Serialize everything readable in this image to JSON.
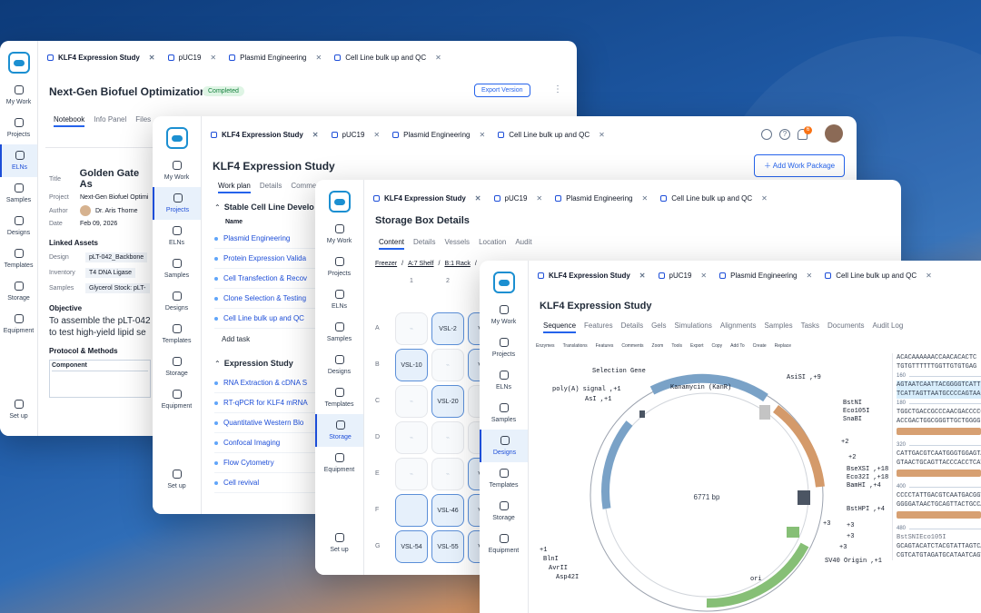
{
  "tabs": {
    "klf4": "KLF4 Expression Study",
    "puc19": "pUC19",
    "plasmid": "Plasmid Engineering",
    "cellline": "Cell Line bulk up and QC"
  },
  "nav": {
    "mywork": "My Work",
    "projects": "Projects",
    "elns": "ELNs",
    "samples": "Samples",
    "designs": "Designs",
    "templates": "Templates",
    "storage": "Storage",
    "equipment": "Equipment",
    "setup": "Set up"
  },
  "win1": {
    "title": "Next-Gen Biofuel Optimization",
    "status": "Completed",
    "export": "Export Version",
    "subtabs": [
      "Notebook",
      "Info Panel",
      "Files"
    ],
    "doc": {
      "title_label": "Title",
      "title_value": "Golden Gate As",
      "project_label": "Project",
      "project_value": "Next-Gen Biofuel Optimi",
      "author_label": "Author",
      "author_value": "Dr. Aris Thorne",
      "date_label": "Date",
      "date_value": "Feb 09, 2026",
      "linked_assets": "Linked Assets",
      "design_label": "Design",
      "design_value": "pLT-042_Backbone",
      "inventory_label": "Inventory",
      "inventory_value": "T4 DNA Ligase",
      "samples_label": "Samples",
      "samples_value": "Glycerol Stock: pLT-",
      "objective": "Objective",
      "objective_text1": "To assemble the pLT-042",
      "objective_text2": "to test high-yield lipid se",
      "protocol": "Protocol & Methods",
      "component": "Component"
    }
  },
  "win2": {
    "title": "KLF4 Expression Study",
    "add_package": "Add Work Package",
    "notif": "6",
    "subtabs": [
      "Work plan",
      "Details",
      "Commer"
    ],
    "group1": "Stable Cell Line Develo",
    "name_col": "Name",
    "items1": [
      "Plasmid Engineering",
      "Protein Expression Valida",
      "Cell Transfection & Recov",
      "Clone Selection & Testing",
      "Cell Line bulk up and QC"
    ],
    "add_task": "Add task",
    "group2": "Expression Study",
    "items2": [
      "RNA Extraction & cDNA S",
      "RT-qPCR for KLF4 mRNA",
      "Quantitative Western Blo",
      "Confocal Imaging",
      "Flow Cytometry",
      "Cell revival"
    ]
  },
  "win3": {
    "title": "Storage Box Details",
    "subtabs": [
      "Content",
      "Details",
      "Vessels",
      "Location",
      "Audit"
    ],
    "breadcrumb": [
      "Freezer",
      "A:7 Shelf",
      "B:1 Rack"
    ],
    "cols": [
      "1",
      "2",
      "3"
    ],
    "rows": [
      "A",
      "B",
      "C",
      "D",
      "E",
      "F",
      "G"
    ],
    "cells": [
      [
        "",
        "VSL-2",
        "VSL"
      ],
      [
        "VSL-10",
        "",
        "VSL"
      ],
      [
        "",
        "VSL-20",
        ""
      ],
      [
        "",
        "",
        ""
      ],
      [
        "",
        "",
        "VSL"
      ],
      [
        "",
        "VSL-46",
        "VSL"
      ],
      [
        "VSL-54",
        "VSL-55",
        "VSL"
      ]
    ]
  },
  "win4": {
    "title": "KLF4 Expression Study",
    "subtabs": [
      "Sequence",
      "Features",
      "Details",
      "Gels",
      "Simulations",
      "Alignments",
      "Samples",
      "Tasks",
      "Documents",
      "Audit Log"
    ],
    "toolbar": [
      "Enzymes",
      "Translations",
      "Features",
      "Comments",
      "Zoom",
      "Tools",
      "Export",
      "Copy",
      "Add To",
      "Create",
      "Replace"
    ],
    "plasmid_size": "6771 bp",
    "labels": [
      "Selection Gene",
      "poly(A) signal ,+1",
      "AsiSI ,+9",
      "AsI ,+1",
      "Kanamycin (KanR)",
      "BstNI",
      "Eco105I",
      "SnaBI",
      "BseXSI ,+18",
      "Eco32I ,+18",
      "BamHI ,+4",
      "BstHPI ,+4",
      "SV40 Origin ,+1",
      "BlnI",
      "AvrII",
      "Asp42I",
      "ori",
      "+2",
      "+2",
      "+3",
      "+3",
      "+3",
      "+3",
      "+1"
    ],
    "seq": [
      "ACACAAAAAACCAACACACTC",
      "TGTGTTTTTTGGTTGTGTGAG",
      "160",
      "AGTAATCAATTACGGGGTCATT",
      "TCATTAGTTAATGCCCCAGTAA",
      "180",
      "TGGCTGACCGCCCAACGACCCCC",
      "ACCGACTGGCGGGTTGCTGGGG",
      "320",
      "CATTGACGTCAATGGGTGGAGTA",
      "GTAACTGCAGTTACCCACCTCAT",
      "400",
      "CCCCTATTGACGTCAATGACGGT",
      "GGGGATAACTGCAGTTACTGCCA",
      "480",
      "BstSNIEco105I",
      "GCAGTACATCTACGTATTAGTCA",
      "CGTCATGTAGATGCATAATCAGT"
    ]
  }
}
